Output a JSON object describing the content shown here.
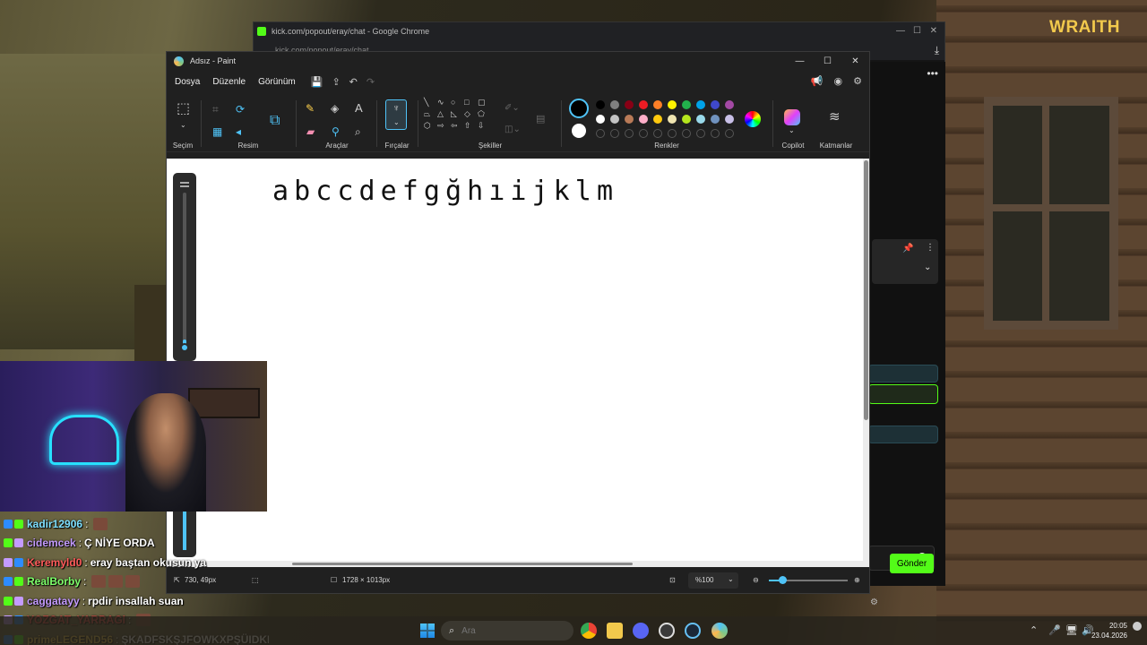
{
  "brand": "WRAITH",
  "chrome": {
    "title": "kick.com/popout/eray/chat - Google Chrome",
    "url": "kick.com/popout/eray/chat",
    "send_label": "Gönder"
  },
  "paint": {
    "title": "Adsız - Paint",
    "menus": [
      "Dosya",
      "Düzenle",
      "Görünüm"
    ],
    "groups": {
      "selection": "Seçim",
      "image": "Resim",
      "tools": "Araçlar",
      "brushes": "Fırçalar",
      "shapes": "Şekiller",
      "colors": "Renkler",
      "copilot": "Copilot",
      "layers": "Katmanlar"
    },
    "palette_row1": [
      "#000000",
      "#7f7f7f",
      "#880015",
      "#ed1c24",
      "#ff7f27",
      "#fff200",
      "#22b14c",
      "#00a2e8",
      "#3f48cc",
      "#a349a4"
    ],
    "palette_row2": [
      "#ffffff",
      "#c3c3c3",
      "#b97a57",
      "#ffaec9",
      "#ffc90e",
      "#efe4b0",
      "#b5e61d",
      "#99d9ea",
      "#7092be",
      "#c8bfe7"
    ],
    "canvas_text": "a b c c d e f g ğ h ı i j k l m",
    "status": {
      "cursor": "730, 49px",
      "canvas_size": "1728 × 1013px",
      "zoom": "%100"
    }
  },
  "chat": [
    {
      "user": "kadir12906",
      "color": "#7ee0ff",
      "message": "",
      "emotes": 1
    },
    {
      "user": "cidemcek",
      "color": "#c49bff",
      "message": "Ç NİYE ORDA",
      "emotes": 0
    },
    {
      "user": "Keremyld0",
      "color": "#ff5a5a",
      "message": "eray baştan okusun ya",
      "emotes": 0
    },
    {
      "user": "RealBorby",
      "color": "#7dff6a",
      "message": "",
      "emotes": 3
    },
    {
      "user": "caggatayy",
      "color": "#c49bff",
      "message": "rpdir insallah suan",
      "emotes": 0
    },
    {
      "user": "YOZGAT_YARRAGI",
      "color": "#ff4d4d",
      "message": "",
      "emotes": 1
    },
    {
      "user": "primeLEGEND56",
      "color": "#ffd24d",
      "message": "ŞKADFSKŞJFOWKXPŞÜIDKEĞ",
      "emotes": 0
    }
  ],
  "taskbar": {
    "search_placeholder": "Ara",
    "time": "20:05",
    "date": "23.04.2026"
  }
}
